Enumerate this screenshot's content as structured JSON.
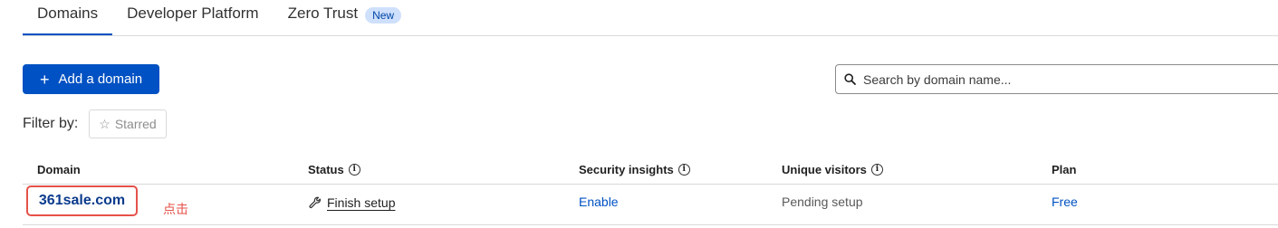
{
  "tabs": [
    {
      "label": "Domains",
      "active": true
    },
    {
      "label": "Developer Platform",
      "active": false
    },
    {
      "label": "Zero Trust",
      "active": false,
      "badge": "New"
    }
  ],
  "toolbar": {
    "add_button_label": "Add a domain",
    "search_placeholder": "Search by domain name..."
  },
  "filter": {
    "label": "Filter by:",
    "starred_label": "Starred"
  },
  "table": {
    "columns": [
      "Domain",
      "Status",
      "Security insights",
      "Unique visitors",
      "Plan"
    ],
    "rows": [
      {
        "domain": "361sale.com",
        "annotation": "点击",
        "status": "Finish setup",
        "security_insights": "Enable",
        "unique_visitors": "Pending setup",
        "plan": "Free"
      }
    ]
  },
  "colors": {
    "accent": "#0051c3",
    "highlight_box": "#e5514a",
    "badge_bg": "#cfe0fc"
  }
}
